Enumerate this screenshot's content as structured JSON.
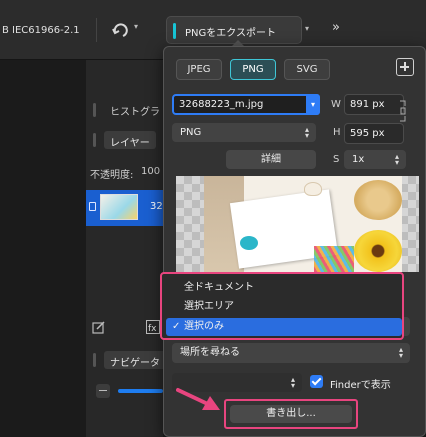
{
  "toolbar": {
    "profile": "B IEC61966-2.1",
    "export_label": "PNGをエクスポート"
  },
  "left": {
    "histogram": "ヒストグラ",
    "layers_tab": "レイヤー",
    "opacity_label": "不透明度:",
    "opacity_value": "100",
    "layer_name": "32",
    "navigator": "ナビゲータ"
  },
  "export": {
    "format_tabs": [
      "JPEG",
      "PNG",
      "SVG"
    ],
    "filename": "32688223_m.jpg",
    "format_value": "PNG",
    "details": "詳細",
    "w_label": "W",
    "w_value": "891 px",
    "h_label": "H",
    "h_value": "595 px",
    "s_label": "S",
    "s_value": "1x",
    "area_menu": {
      "items": [
        "全ドキュメント",
        "選択エリア",
        "選択のみ"
      ],
      "selected": "選択のみ",
      "check": "✓"
    },
    "location": "場所を尋ねる",
    "finder_label": "Finderで表示",
    "export_button": "書き出し..."
  },
  "colors": {
    "accent": "#17c5d6",
    "selection": "#2a6ddf",
    "highlight": "#e8457f"
  }
}
